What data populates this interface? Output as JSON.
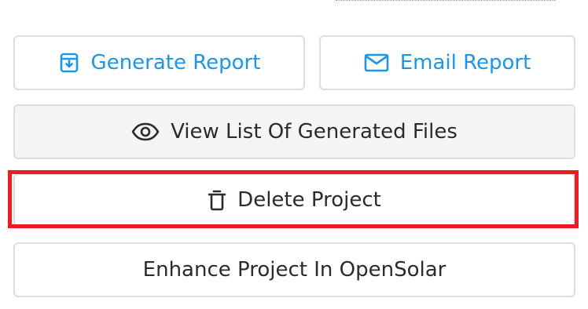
{
  "buttons": {
    "generate_report": {
      "label": "Generate Report",
      "icon": "download-box-icon"
    },
    "email_report": {
      "label": "Email Report",
      "icon": "mail-icon"
    },
    "view_files": {
      "label": "View List Of Generated Files",
      "icon": "eye-icon"
    },
    "delete_project": {
      "label": "Delete Project",
      "icon": "trash-icon"
    },
    "enhance_project": {
      "label": "Enhance Project In OpenSolar"
    }
  },
  "colors": {
    "accent": "#1e96e6",
    "highlight": "#ea1c24",
    "text": "#2b2b2b",
    "border": "#dedede",
    "secondary_bg": "#f5f5f5"
  }
}
